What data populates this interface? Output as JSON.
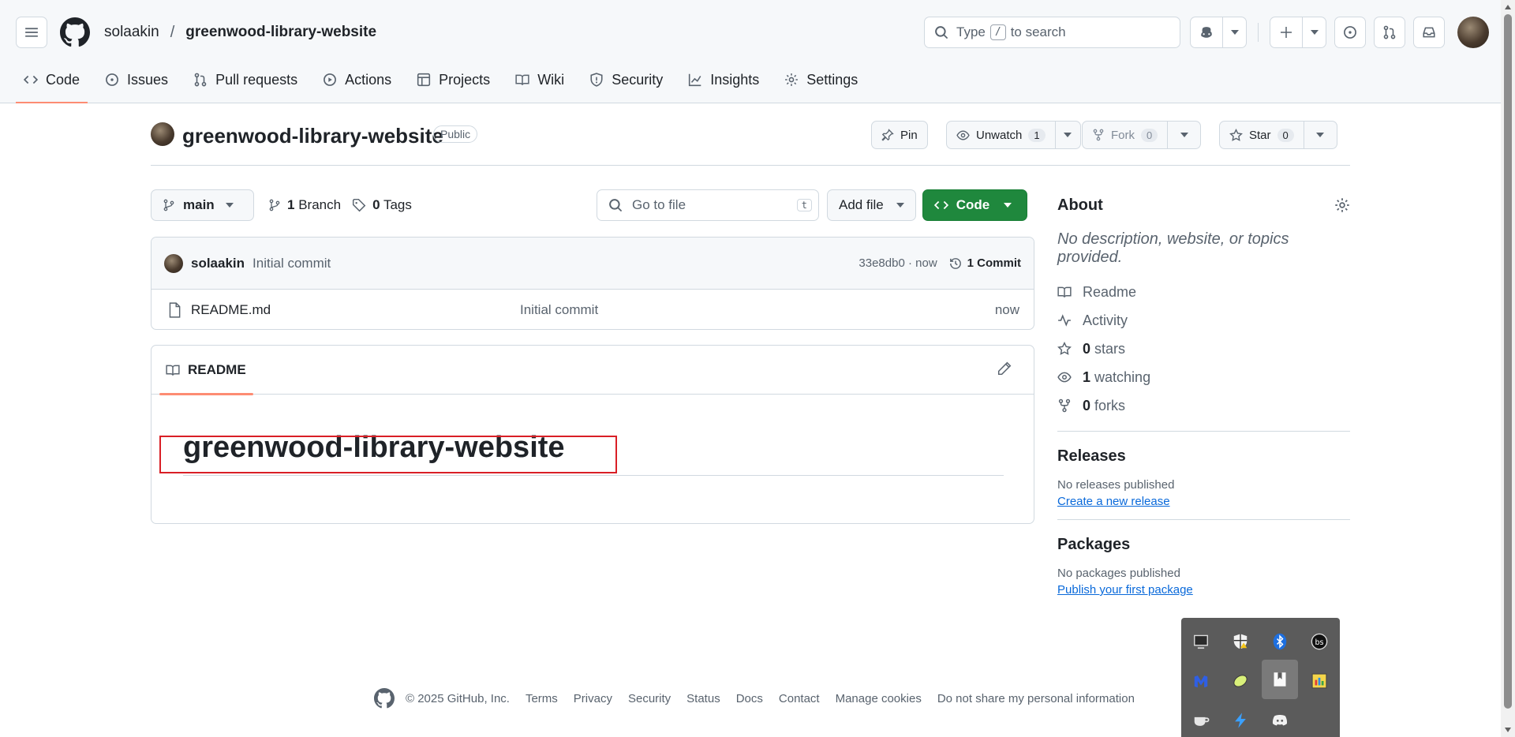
{
  "header": {
    "owner": "solaakin",
    "separator": "/",
    "repo": "greenwood-library-website",
    "search_prefix": "Type",
    "search_key": "/",
    "search_suffix": "to search"
  },
  "tabs": [
    {
      "label": "Code"
    },
    {
      "label": "Issues"
    },
    {
      "label": "Pull requests"
    },
    {
      "label": "Actions"
    },
    {
      "label": "Projects"
    },
    {
      "label": "Wiki"
    },
    {
      "label": "Security"
    },
    {
      "label": "Insights"
    },
    {
      "label": "Settings"
    }
  ],
  "repo": {
    "title": "greenwood-library-website",
    "visibility": "Public",
    "pin_label": "Pin",
    "unwatch_label": "Unwatch",
    "watch_count": "1",
    "fork_label": "Fork",
    "fork_count": "0",
    "star_label": "Star",
    "star_count": "0"
  },
  "filebar": {
    "branch": "main",
    "branch_count": "1",
    "branch_label": "Branch",
    "tag_count": "0",
    "tag_label": "Tags",
    "goto_placeholder": "Go to file",
    "goto_key": "t",
    "add_file": "Add file",
    "code": "Code"
  },
  "commit": {
    "author": "solaakin",
    "message": "Initial commit",
    "hash_time": "33e8db0 · now",
    "commits_label": "1 Commit"
  },
  "files": [
    {
      "name": "README.md",
      "message": "Initial commit",
      "time": "now"
    }
  ],
  "readme": {
    "tab_label": "README",
    "heading": "greenwood-library-website"
  },
  "about": {
    "title": "About",
    "description": "No description, website, or topics provided.",
    "readme": "Readme",
    "activity": "Activity",
    "stars_count": "0",
    "stars_label": "stars",
    "watching_count": "1",
    "watching_label": "watching",
    "forks_count": "0",
    "forks_label": "forks"
  },
  "releases": {
    "title": "Releases",
    "none": "No releases published",
    "link": "Create a new release"
  },
  "packages": {
    "title": "Packages",
    "none": "No packages published",
    "link": "Publish your first package"
  },
  "footer": {
    "copyright": "© 2025 GitHub, Inc.",
    "links": [
      "Terms",
      "Privacy",
      "Security",
      "Status",
      "Docs",
      "Contact",
      "Manage cookies",
      "Do not share my personal information"
    ]
  },
  "colors": {
    "accent_underline": "#fd8c73",
    "primary_green": "#1f883d",
    "link_blue": "#0969da",
    "highlight_red": "#d91f26"
  },
  "tray_icons": [
    "monitor-icon",
    "shield-warning-icon",
    "bluetooth-icon",
    "bs-icon",
    "malwarebytes-icon",
    "lemon-icon",
    "bookmark-icon",
    "screen-color-icon",
    "teacup-icon",
    "bolt-icon",
    "discord-icon"
  ]
}
